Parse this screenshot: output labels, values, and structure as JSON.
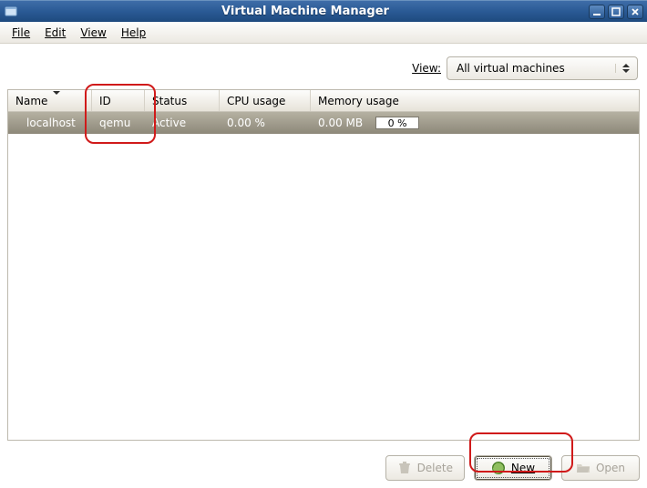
{
  "window": {
    "title": "Virtual Machine Manager"
  },
  "menu": {
    "file": "File",
    "edit": "Edit",
    "view": "View",
    "help": "Help"
  },
  "filter": {
    "label": "View:",
    "selected": "All virtual machines"
  },
  "table": {
    "headers": {
      "name": "Name",
      "id": "ID",
      "status": "Status",
      "cpu": "CPU usage",
      "mem": "Memory usage"
    },
    "rows": [
      {
        "name": "localhost",
        "id": "qemu",
        "status": "Active",
        "cpu": "0.00 %",
        "mem_text": "0.00 MB",
        "mem_bar": "0 %"
      }
    ]
  },
  "buttons": {
    "delete": "Delete",
    "new": "New",
    "open": "Open"
  }
}
